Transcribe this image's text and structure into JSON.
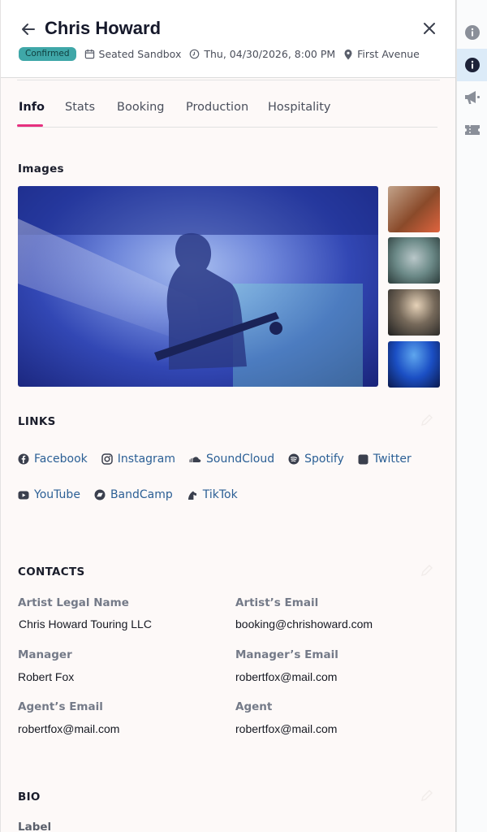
{
  "header": {
    "title": "Chris Howard",
    "status": "Confirmed",
    "venue": "Seated Sandbox",
    "datetime": "Thu, 04/30/2026, 8:00 PM",
    "location": "First Avenue"
  },
  "tabs": [
    {
      "label": "Info",
      "active": true
    },
    {
      "label": "Stats",
      "active": false
    },
    {
      "label": "Booking",
      "active": false
    },
    {
      "label": "Production",
      "active": false
    },
    {
      "label": "Hospitality",
      "active": false
    }
  ],
  "images": {
    "title": "Images"
  },
  "links": {
    "title": "LINKS",
    "items": [
      {
        "label": "Facebook",
        "icon": "facebook-icon"
      },
      {
        "label": "Instagram",
        "icon": "instagram-icon"
      },
      {
        "label": "SoundCloud",
        "icon": "soundcloud-icon"
      },
      {
        "label": "Spotify",
        "icon": "spotify-icon"
      },
      {
        "label": "Twitter",
        "icon": "twitter-icon"
      },
      {
        "label": "YouTube",
        "icon": "youtube-icon"
      },
      {
        "label": "BandCamp",
        "icon": "bandcamp-icon"
      },
      {
        "label": "TikTok",
        "icon": "tiktok-icon"
      }
    ]
  },
  "contacts": {
    "title": "CONTACTS",
    "fields": [
      {
        "label": "Artist Legal Name",
        "value": "Chris Howard Touring LLC"
      },
      {
        "label": "Artist’s Email",
        "value": "booking@chrishoward.com"
      },
      {
        "label": "Manager",
        "value": "Robert Fox"
      },
      {
        "label": "Manager’s Email",
        "value": "robertfox@mail.com"
      },
      {
        "label": "Agent’s Email",
        "value": "robertfox@mail.com"
      },
      {
        "label": "Agent",
        "value": "robertfox@mail.com"
      }
    ]
  },
  "bio": {
    "title": "BIO",
    "label": "Label"
  },
  "rail": [
    "info-outline-icon",
    "info-filled-icon",
    "megaphone-icon",
    "ticket-icon"
  ],
  "colors": {
    "accent": "#e7307f",
    "badge": "#3fa7a8",
    "link": "#2b5f95",
    "rail_active": "#dcebf8"
  }
}
